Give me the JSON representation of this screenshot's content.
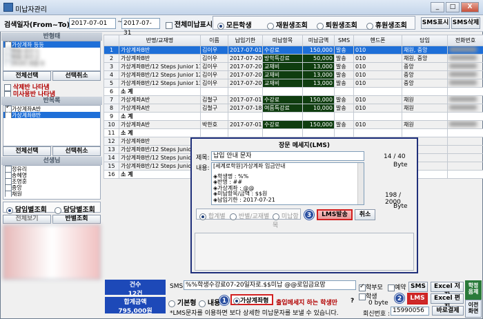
{
  "window": {
    "title": "미납자관리",
    "min": "_",
    "max": "□",
    "close": "X"
  },
  "toolbar": {
    "search_label": "검색일자(From~To)",
    "date_from": "2017-07-01",
    "tilde": "~",
    "date_to": "2017-07-31",
    "show_all_unpaid": "전체미납표시",
    "filters": [
      {
        "label": "모든학생",
        "on": true
      },
      {
        "label": "재원생조회",
        "on": false
      },
      {
        "label": "퇴원생조회",
        "on": false
      },
      {
        "label": "휴원생조회",
        "on": false
      }
    ],
    "sms_show": "SMS표시",
    "sms_delete": "SMS삭제"
  },
  "sidebar": {
    "class_header": "반형태",
    "class_items": [
      {
        "label": "가상계좌 등등",
        "checked": true,
        "sel": true
      },
      {
        "label": "학원 친구 1",
        "checked": false
      },
      {
        "label": "학원 친구 2",
        "checked": false
      },
      {
        "label": "가나다 초등 0",
        "checked": false
      }
    ],
    "select_all": "전체선택",
    "deselect_all": "선택취소",
    "check_options": [
      {
        "label": "삭제반 나타냄",
        "checked": false
      },
      {
        "label": "미사용반 나타냄",
        "checked": false
      }
    ],
    "class_list_header": "반목록",
    "class_list": [
      {
        "label": "가상계좌A반",
        "checked": true,
        "sel": false
      },
      {
        "label": "가상계좌B반",
        "checked": true,
        "sel": true
      }
    ],
    "select_all2": "전체선택",
    "deselect_all2": "선택취소",
    "teacher_header": "선생님",
    "teachers": [
      "정유리",
      "송혜영",
      "조영훈",
      "중앙",
      "채원"
    ],
    "view_options": [
      {
        "label": "담임별조회",
        "on": true
      },
      {
        "label": "담당별조회",
        "on": false
      }
    ],
    "view_all": "전체보기",
    "view_by_class": "반별조회",
    "count_label": "건수",
    "count_value": "12건",
    "total_label": "합계금액",
    "total_value": "795,000원"
  },
  "grid": {
    "columns": [
      "",
      "반명/교재명",
      "이름",
      "납입기한",
      "미납항목",
      "미납금액",
      "SMS",
      "핸드폰",
      "담임",
      "전화번호"
    ],
    "rows": [
      {
        "n": "1",
        "class": "가상계좌B반",
        "name": "김이우",
        "due": "2017-07-01",
        "item": "수강료",
        "amount": "150,000",
        "sms": "발송",
        "phone": "010",
        "teacher": "채원, 중앙",
        "type": "sel"
      },
      {
        "n": "2",
        "class": "가상계좌B반",
        "name": "김이우",
        "due": "2017-07-20",
        "item": "방학특강료",
        "amount": "50,000",
        "sms": "발송",
        "phone": "010",
        "teacher": "채원, 중앙",
        "type": "d"
      },
      {
        "n": "3",
        "class": "가상계좌B반/12 Steps Junior 11",
        "name": "김이우",
        "due": "2017-07-20",
        "item": "교재비",
        "amount": "13,000",
        "sms": "발송",
        "phone": "010",
        "teacher": "중앙",
        "type": "d"
      },
      {
        "n": "4",
        "class": "가상계좌B반/12 Steps Junior 12",
        "name": "김이우",
        "due": "2017-07-20",
        "item": "교재비",
        "amount": "13,000",
        "sms": "발송",
        "phone": "010",
        "teacher": "중앙",
        "type": "d"
      },
      {
        "n": "5",
        "class": "가상계좌B반/12 Steps Junior 13",
        "name": "김이우",
        "due": "2017-07-20",
        "item": "교재비",
        "amount": "13,000",
        "sms": "발송",
        "phone": "010",
        "teacher": "중앙",
        "type": "d"
      },
      {
        "n": "6",
        "class": "소 계",
        "name": "",
        "due": "",
        "item": "",
        "amount": "239,000",
        "sms": "",
        "phone": "",
        "teacher": "",
        "type": "sub"
      },
      {
        "n": "7",
        "class": "가상계좌A반",
        "name": "김철구",
        "due": "2017-07-01",
        "item": "수강료",
        "amount": "150,000",
        "sms": "발송",
        "phone": "010",
        "teacher": "채원",
        "type": "d"
      },
      {
        "n": "8",
        "class": "가상계좌A반",
        "name": "김철구",
        "due": "2017-07-18",
        "item": "여름특강료",
        "amount": "10,000",
        "sms": "발송",
        "phone": "010",
        "teacher": "채원",
        "type": "d"
      },
      {
        "n": "9",
        "class": "소 계",
        "name": "",
        "due": "",
        "item": "",
        "amount": "160,000",
        "sms": "",
        "phone": "",
        "teacher": "",
        "type": "sub"
      },
      {
        "n": "10",
        "class": "가상계좌A반",
        "name": "박한호",
        "due": "2017-07-01",
        "item": "수강료",
        "amount": "150,000",
        "sms": "발송",
        "phone": "010",
        "teacher": "채원",
        "type": "d"
      },
      {
        "n": "11",
        "class": "소 계",
        "name": "",
        "due": "",
        "item": "",
        "amount": "",
        "sms": "",
        "phone": "",
        "teacher": "",
        "type": "sub"
      },
      {
        "n": "12",
        "class": "가상계좌B반",
        "name": "",
        "due": "",
        "item": "",
        "amount": "",
        "sms": "",
        "phone": "",
        "teacher": "",
        "type": "p"
      },
      {
        "n": "13",
        "class": "가상계좌B반/12 Steps Junior",
        "name": "",
        "due": "",
        "item": "",
        "amount": "",
        "sms": "",
        "phone": "",
        "teacher": "",
        "type": "p"
      },
      {
        "n": "14",
        "class": "가상계좌B반/12 Steps Junior",
        "name": "",
        "due": "",
        "item": "",
        "amount": "",
        "sms": "",
        "phone": "",
        "teacher": "",
        "type": "p"
      },
      {
        "n": "15",
        "class": "가상계좌B반/12 Steps Junior",
        "name": "",
        "due": "",
        "item": "",
        "amount": "",
        "sms": "",
        "phone": "",
        "teacher": "",
        "type": "p"
      },
      {
        "n": "16",
        "class": "소 계",
        "name": "",
        "due": "",
        "item": "",
        "amount": "",
        "sms": "",
        "phone": "",
        "teacher": "",
        "type": "sub"
      }
    ]
  },
  "modal": {
    "title": "장문 메세지(LMS)",
    "subject_label": "제목:",
    "subject": "납입 안내 문자",
    "subject_count": "14 / 40",
    "byte1": "Byte",
    "content_label": "내용:",
    "content_lines": [
      "[세계로학원]가상계좌 입금안내",
      "",
      "◈학생명 : %%",
      "◈반명 : ##",
      "◈가상계좌 : @@",
      "◈미납항목/금액 : $$원",
      "◈납입기한 : 2017-07-21"
    ],
    "content_count": "198 / 2000",
    "byte2": "Byte",
    "radios": [
      {
        "label": "합계별",
        "on": true
      },
      {
        "label": "반별/교재별",
        "on": false
      },
      {
        "label": "미납항목",
        "on": false
      }
    ],
    "badge": "3",
    "send": "LMS발송",
    "cancel": "취소"
  },
  "footer": {
    "sms_label": "SMS",
    "sms_text": "%%학생수강료07-20일자로.$$미납  @@로입금요망",
    "templates": [
      {
        "label": "기본형",
        "on": false
      },
      {
        "label": "내용",
        "on": false
      },
      {
        "label": "가상계좌형",
        "on": true
      }
    ],
    "badge1": "1",
    "note": "출입메세지 하는 학생만",
    "q": "?",
    "info": "*LMS문자를 이용하면    보다 상세한 미납문자를 보낼 수 있습니다.",
    "parent_label": "학부모",
    "parent_checked": true,
    "reserve_label": "예약",
    "reserve_checked": false,
    "student_label": "학생",
    "student_checked": false,
    "byte_text": "0 byte",
    "badge2": "2",
    "sms_btn": "SMS",
    "lms_btn": "LMS",
    "excel_save": "Excel 저장",
    "excel_edit": "Excel 편집",
    "callback_label": "회신번호 :",
    "callback": "15990056",
    "bar_pay": "바로결제",
    "side1": "학정 음제",
    "side2": "이전 화면"
  },
  "colors": {
    "selection": "#1e6fd8",
    "dark_cell": "#0f3d0f",
    "highlight": "#d21f1f",
    "badge": "#2a4fa0",
    "bottom_blue": "#1d49b8"
  }
}
